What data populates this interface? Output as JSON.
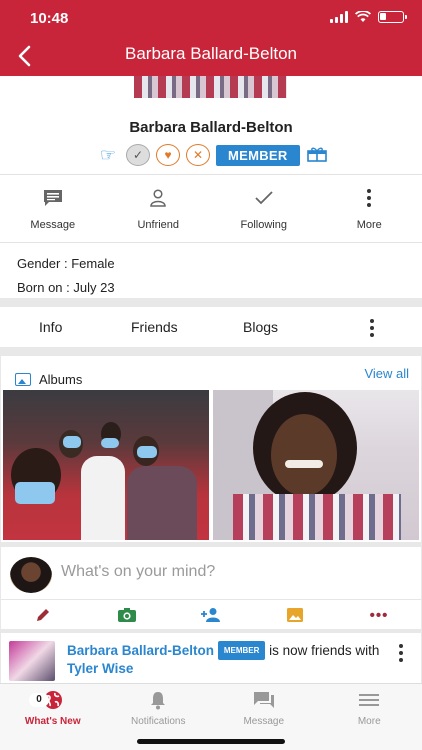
{
  "status": {
    "time": "10:48"
  },
  "header": {
    "title": "Barbara Ballard-Belton"
  },
  "profile": {
    "name": "Barbara Ballard-Belton",
    "member_label": "MEMBER",
    "actions": [
      {
        "label": "Message",
        "icon": "message-icon"
      },
      {
        "label": "Unfriend",
        "icon": "person-icon"
      },
      {
        "label": "Following",
        "icon": "check-icon"
      },
      {
        "label": "More",
        "icon": "more-icon"
      }
    ],
    "gender": "Gender : Female",
    "born": "Born on : July 23"
  },
  "tabs": [
    "Info",
    "Friends",
    "Blogs"
  ],
  "albums": {
    "title": "Albums",
    "view_all": "View all"
  },
  "composer": {
    "placeholder": "What's on your mind?"
  },
  "feed": [
    {
      "name": "Barbara Ballard-Belton",
      "badge": "MEMBER",
      "text": " is now friends with ",
      "friend": "Tyler Wise"
    }
  ],
  "bottom_nav": [
    {
      "label": "What's New",
      "icon": "globe-icon",
      "active": true,
      "count": "0"
    },
    {
      "label": "Notifications",
      "icon": "bell-icon"
    },
    {
      "label": "Message",
      "icon": "chat-icon"
    },
    {
      "label": "More",
      "icon": "menu-icon"
    }
  ],
  "colors": {
    "brand": "#c8253a",
    "accent": "#2a86cf",
    "reaction": "#e07a2a"
  }
}
